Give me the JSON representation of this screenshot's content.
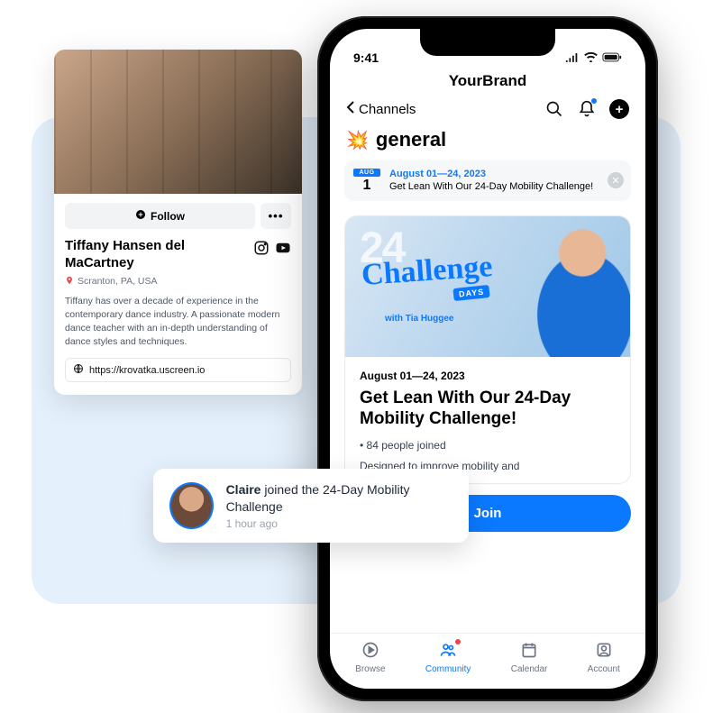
{
  "profile": {
    "follow_label": "Follow",
    "name": "Tiffany Hansen del MaCartney",
    "location": "Scranton, PA, USA",
    "bio": "Tiffany has over a decade of experience in the contemporary dance industry. A passionate modern dance teacher with an in-depth understanding of dance styles and techniques.",
    "website": "https://krovatka.uscreen.io"
  },
  "toast": {
    "user": "Claire",
    "action_text": " joined the 24-Day Mobility Challenge",
    "time": "1 hour ago"
  },
  "phone": {
    "time": "9:41",
    "brand": "YourBrand",
    "back_label": "Channels",
    "channel_emoji": "💥",
    "channel_name": "general",
    "pinned": {
      "month": "AUG",
      "day": "1",
      "title": "August 01—24, 2023",
      "subtitle": "Get Lean With Our 24-Day Mobility Challenge!"
    },
    "hero": {
      "big": "24",
      "script": "Challenge",
      "days": "DAYS",
      "with": "with Tia Huggee"
    },
    "card": {
      "date": "August 01—24, 2023",
      "title": "Get Lean With Our 24-Day Mobility Challenge!",
      "joined": "84 people joined",
      "desc_fragment": "Designed to improve mobility and"
    },
    "join_label": "Join",
    "tabs": {
      "browse": "Browse",
      "community": "Community",
      "calendar": "Calendar",
      "account": "Account"
    }
  }
}
